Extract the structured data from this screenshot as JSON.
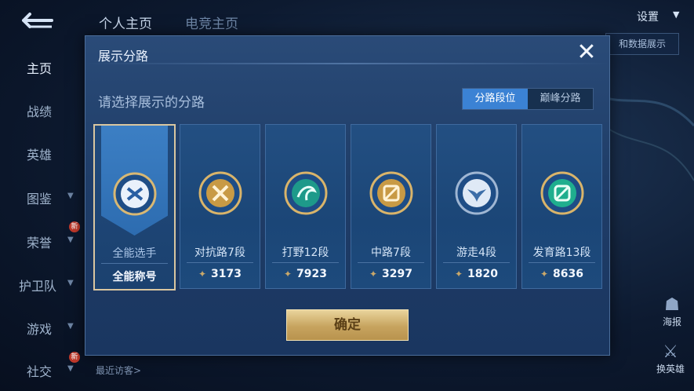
{
  "background": {
    "sidebar_items": [
      "主页",
      "战绩",
      "英雄",
      "图鉴",
      "荣誉",
      "护卫队",
      "游戏",
      "社交"
    ],
    "top_tabs": [
      "个人主页",
      "电竞主页"
    ],
    "settings_label": "设置",
    "data_button_label": "和数据展示",
    "recent_visitors_label": "最近访客>",
    "right_tools": [
      "海报",
      "换英雄"
    ],
    "badge_new": "新"
  },
  "modal": {
    "title": "展示分路",
    "close_symbol": "✕",
    "subtitle": "请选择展示的分路",
    "toggle": {
      "left": "分路段位",
      "right": "巅峰分路",
      "active": "left"
    },
    "cards": [
      {
        "name": "全能选手",
        "value": "全能称号",
        "icon": "all-round-emblem-icon",
        "selected": true
      },
      {
        "name": "对抗路7段",
        "value": "3173",
        "icon": "clash-lane-emblem-icon",
        "selected": false
      },
      {
        "name": "打野12段",
        "value": "7923",
        "icon": "jungle-emblem-icon",
        "selected": false
      },
      {
        "name": "中路7段",
        "value": "3297",
        "icon": "mid-lane-emblem-icon",
        "selected": false
      },
      {
        "name": "游走4段",
        "value": "1820",
        "icon": "roam-emblem-icon",
        "selected": false
      },
      {
        "name": "发育路13段",
        "value": "8636",
        "icon": "farm-lane-emblem-icon",
        "selected": false
      }
    ],
    "confirm_label": "确定"
  },
  "colors": {
    "accent_blue": "#3b82d4",
    "gold": "#c7a45f",
    "panel": "#1f3d68"
  }
}
